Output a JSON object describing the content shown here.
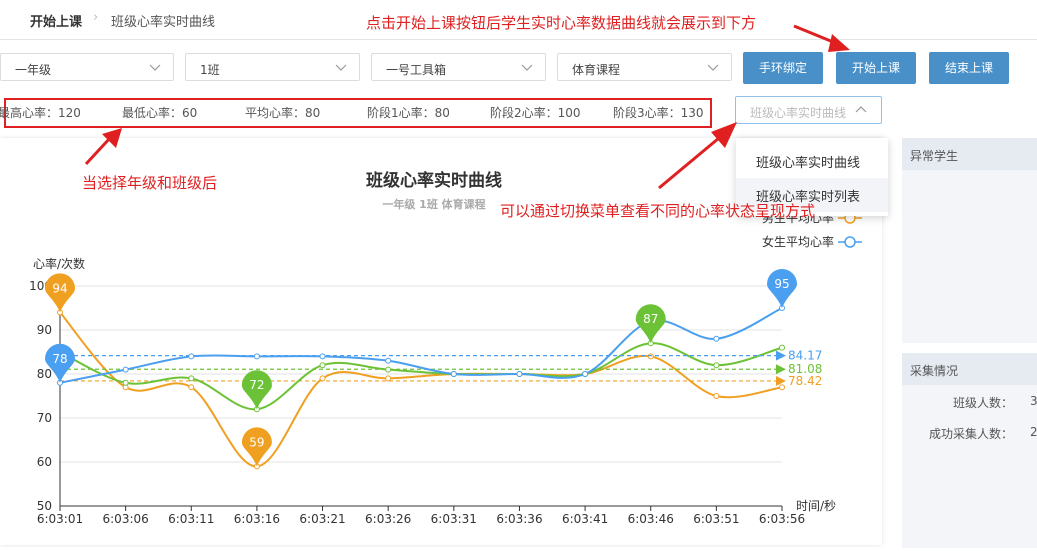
{
  "breadcrumb": {
    "home": "开始上课",
    "current": "班级心率实时曲线"
  },
  "annotations": {
    "top": "点击开始上课按钮后学生实时心率数据曲线就会展示到下方",
    "left": "当选择年级和班级后",
    "middle": "可以通过切换菜单查看不同的心率状态呈现方式"
  },
  "filters": {
    "grade": "一年级",
    "class": "1班",
    "toolbox": "一号工具箱",
    "course": "体育课程"
  },
  "buttons": {
    "bind": "手环绑定",
    "start": "开始上课",
    "end": "结束上课"
  },
  "stats": {
    "max": "最高心率：120",
    "min": "最低心率：60",
    "avg": "平均心率：80",
    "stage1": "阶段1心率：80",
    "stage2": "阶段2心率：100",
    "stage3": "阶段3心率：130"
  },
  "view_mode": {
    "placeholder": "班级心率实时曲线",
    "options": [
      "班级心率实时曲线",
      "班级心率实时列表"
    ]
  },
  "side": {
    "abnormal_title": "异常学生",
    "collect_title": "采集情况",
    "class_count_label": "班级人数：",
    "class_count_value": "3",
    "success_label": "成功采集人数：",
    "success_value": "2"
  },
  "colors": {
    "avg": "#f0a020",
    "male": "#6cc236",
    "female": "#4a9ff0",
    "annotation": "#e02020",
    "button": "#4a90c8"
  },
  "chart_data": {
    "type": "line",
    "title": "班级心率实时曲线",
    "subtitle": "一年级 1班 体育课程",
    "ylabel": "心率/次数",
    "xlabel": "时间/秒",
    "ylim": [
      50,
      100
    ],
    "yticks": [
      50,
      60,
      70,
      80,
      90,
      100
    ],
    "categories": [
      "6:03:01",
      "6:03:06",
      "6:03:11",
      "6:03:16",
      "6:03:21",
      "6:03:26",
      "6:03:31",
      "6:03:36",
      "6:03:41",
      "6:03:46",
      "6:03:51",
      "6:03:56"
    ],
    "legend_position": "top-right",
    "series": [
      {
        "name": "男生平均心率",
        "key": "avg",
        "values": [
          94,
          77,
          77,
          59,
          79,
          79,
          80,
          80,
          80,
          84,
          75,
          77
        ],
        "mark_line": 78.42,
        "mark_label": "78.42",
        "mark_points": [
          {
            "index": 0,
            "label": "94"
          },
          {
            "index": 3,
            "label": "59"
          }
        ]
      },
      {
        "key": "male",
        "values": [
          85,
          78,
          79,
          72,
          82,
          81,
          80,
          80,
          80,
          87,
          82,
          86
        ],
        "mark_line": 81.08,
        "mark_label": "81.08",
        "mark_points": [
          {
            "index": 3,
            "label": "72"
          },
          {
            "index": 9,
            "label": "87"
          }
        ]
      },
      {
        "name": "女生平均心率",
        "key": "female",
        "values": [
          78,
          81,
          84,
          84,
          84,
          83,
          80,
          80,
          80,
          92,
          88,
          95
        ],
        "mark_line": 84.17,
        "mark_label": "84.17",
        "mark_points": [
          {
            "index": 0,
            "label": "78"
          },
          {
            "index": 11,
            "label": "95"
          }
        ]
      }
    ]
  }
}
